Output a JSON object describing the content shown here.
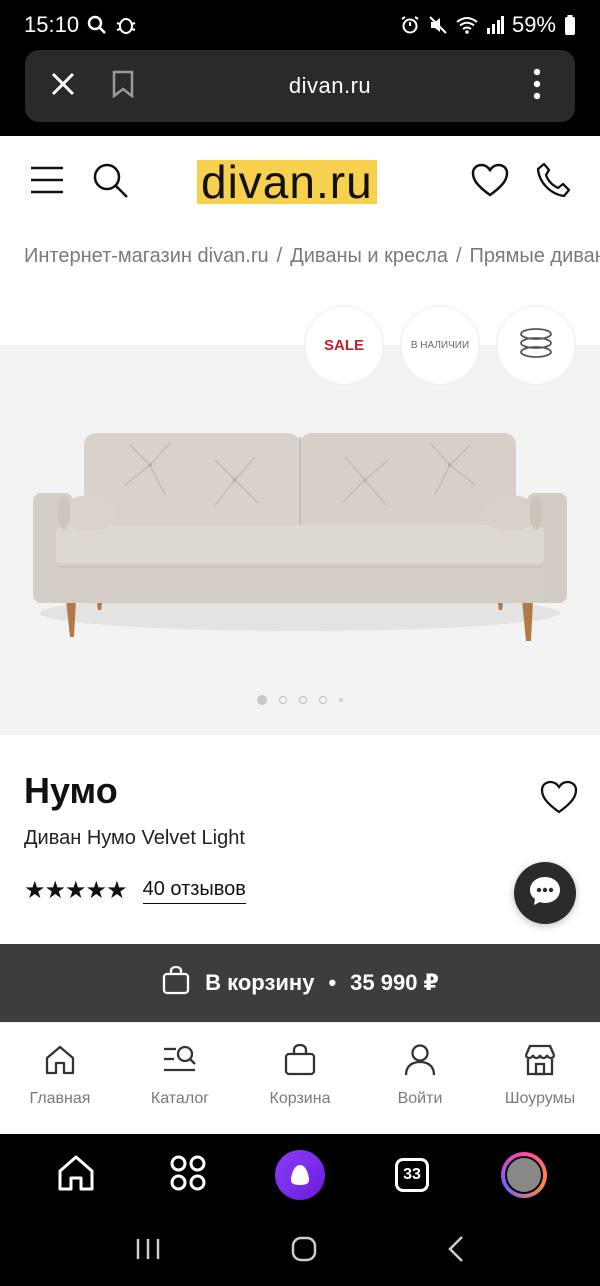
{
  "status_bar": {
    "time": "15:10",
    "battery": "59%"
  },
  "browser": {
    "url": "divan.ru"
  },
  "site": {
    "logo": "divan.ru"
  },
  "breadcrumbs": [
    "Интернет-магазин divan.ru",
    "Диваны и кресла",
    "Прямые диваны"
  ],
  "badges": {
    "sale": "SALE",
    "in_stock": "В НАЛИЧИИ"
  },
  "gallery": {
    "image_count": 5,
    "active_index": 0
  },
  "product": {
    "name": "Нумо",
    "subtitle": "Диван Нумо Velvet Light",
    "stars": "★★★★★",
    "reviews": "40 отзывов",
    "rating": 5
  },
  "cart": {
    "label": "В корзину",
    "price": "35 990 ₽"
  },
  "site_nav": [
    {
      "label": "Главная",
      "icon": "home-icon"
    },
    {
      "label": "Каталог",
      "icon": "catalog-icon"
    },
    {
      "label": "Корзина",
      "icon": "bag-icon"
    },
    {
      "label": "Войти",
      "icon": "user-icon"
    },
    {
      "label": "Шоурумы",
      "icon": "store-icon"
    }
  ],
  "browser_bottom": {
    "tabs_count": "33"
  },
  "colors": {
    "logo_bg": "#f7d14e",
    "sale": "#c2202a",
    "cart_bar": "#3d3d3d",
    "alice": "#8a3ffc"
  }
}
